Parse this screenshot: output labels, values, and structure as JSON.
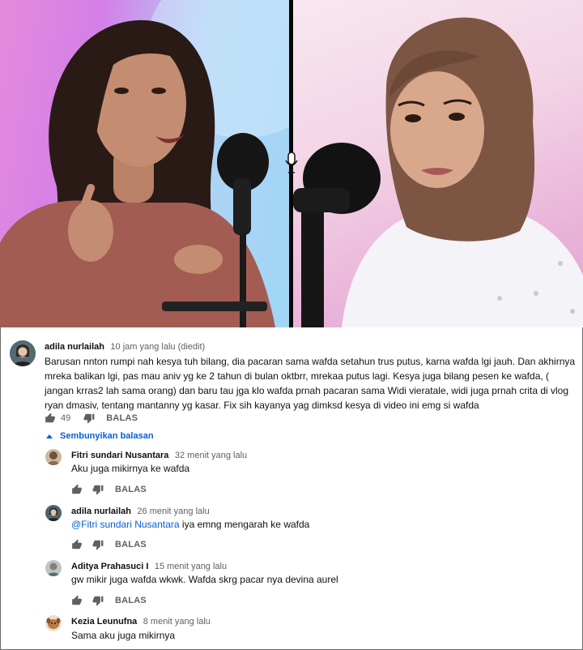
{
  "video": {
    "icons": [
      "microphone-icon"
    ]
  },
  "main_comment": {
    "author": "adila nurlailah",
    "time": "10 jam yang lalu (diedit)",
    "text": "Barusan nnton rumpi nah kesya tuh bilang, dia pacaran sama wafda setahun trus putus, karna wafda lgi jauh. Dan akhirnya mreka balikan lgi, pas mau aniv yg ke 2 tahun di bulan oktbrr, mrekaa putus lagi. Kesya juga bilang pesen ke wafda, ( jangan krras2 lah sama orang)  dan baru tau jga klo wafda prnah pacaran sama Widi vieratale, widi juga prnah crita di vlog ryan dmasiv, tentang mantanny yg kasar. Fix sih kayanya yag dimksd kesya di video ini emg si wafda",
    "likes": "49",
    "reply_label": "BALAS"
  },
  "replies_toggle": "Sembunyikan balasan",
  "replies": [
    {
      "author": "Fitri sundari Nusantara",
      "time": "32 menit yang lalu",
      "mention": "",
      "text": "Aku juga mikirnya ke wafda",
      "reply_label": "BALAS"
    },
    {
      "author": "adila nurlailah",
      "time": "26 menit yang lalu",
      "mention": "@Fitri sundari Nusantara",
      "text": " iya emng mengarah ke wafda",
      "reply_label": "BALAS"
    },
    {
      "author": "Aditya Prahasuci I",
      "time": "15 menit yang lalu",
      "mention": "",
      "text": "gw mikir juga wafda wkwk. Wafda skrg pacar nya devina aurel",
      "reply_label": "BALAS"
    },
    {
      "author": "Kezia Leunufna",
      "time": "8 menit yang lalu",
      "mention": "",
      "text": "Sama aku juga mikirnya",
      "reply_label": ""
    }
  ],
  "colors": {
    "link": "#065fd4",
    "meta_gray": "#606060"
  }
}
